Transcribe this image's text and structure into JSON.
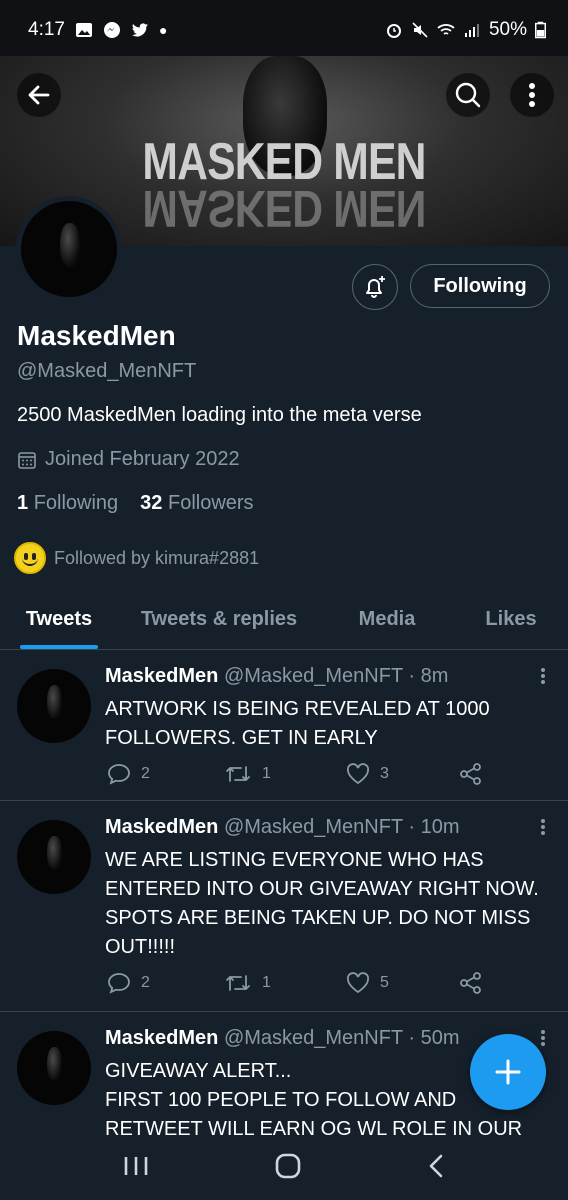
{
  "status_bar": {
    "time": "4:17",
    "battery": "50%"
  },
  "banner": {
    "title": "MASKED MEN"
  },
  "profile": {
    "name": "MaskedMen",
    "handle": "@Masked_MenNFT",
    "bio": "2500 MaskedMen loading into the meta verse",
    "joined": "Joined February 2022",
    "following_count": "1",
    "following_label": "Following",
    "followers_count": "32",
    "followers_label": "Followers",
    "followed_by": "Followed by kimura#2881",
    "follow_button": "Following"
  },
  "tabs": [
    {
      "label": "Tweets",
      "active": true
    },
    {
      "label": "Tweets & replies"
    },
    {
      "label": "Media"
    },
    {
      "label": "Likes"
    }
  ],
  "tweets": [
    {
      "name": "MaskedMen",
      "handle": "@Masked_MenNFT · 8m",
      "text": "ARTWORK IS BEING REVEALED AT 1000 FOLLOWERS. GET IN EARLY",
      "replies": "2",
      "retweets": "1",
      "likes": "3"
    },
    {
      "name": "MaskedMen",
      "handle": "@Masked_MenNFT · 10m",
      "text": "WE ARE LISTING EVERYONE WHO HAS ENTERED INTO OUR GIVEAWAY RIGHT NOW. SPOTS ARE BEING TAKEN UP. DO NOT MISS OUT!!!!!",
      "replies": "2",
      "retweets": "1",
      "likes": "5"
    },
    {
      "name": "MaskedMen",
      "handle": "@Masked_MenNFT · 50m",
      "line1": "GIVEAWAY ALERT...",
      "text": "FIRST 100 PEOPLE TO FOLLOW AND RETWEET WILL EARN OG WL ROLE IN OUR"
    }
  ],
  "colors": {
    "background": "#15202b",
    "accent": "#1d9bf0",
    "muted": "#8b98a5"
  }
}
